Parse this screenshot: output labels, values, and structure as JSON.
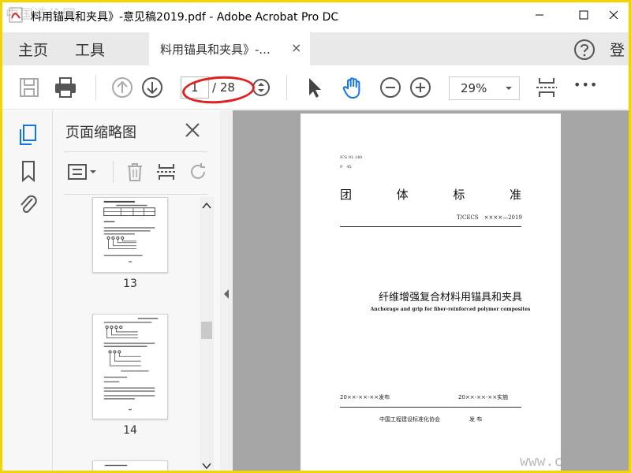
{
  "window": {
    "title": "料用锚具和夹具》-意见稿2019.pdf - Adobe Acrobat Pro DC",
    "watermark": "中国造价网"
  },
  "nav": {
    "home": "主页",
    "tools": "工具",
    "doc_tab": "料用锚具和夹具》-...",
    "close": "×",
    "signin": "登"
  },
  "toolbar": {
    "current_page": "1",
    "total_pages": "/ 28",
    "zoom": "29%",
    "more": "•••"
  },
  "panel": {
    "title": "页面缩略图",
    "thumbnails": [
      {
        "page": "13"
      },
      {
        "page": "14"
      }
    ]
  },
  "document": {
    "ics": "ICS 91.140",
    "p": "P　45",
    "std_chars": [
      "团",
      "体",
      "标",
      "准"
    ],
    "code": "T/CECS　××××—2019",
    "cn_title": "纤维增强复合材料用锚具和夹具",
    "en_title": "Anchorage and grip for fiber-reinforced polymer composites",
    "publish": "20××-××-××发布",
    "implement": "20××-××-××实施",
    "org": "中国工程建设标准化协会",
    "org_suffix": "发 布"
  },
  "site_watermark": "www.c",
  "colors": {
    "border": "#f3d400",
    "accent": "#1473e6",
    "annotation": "#e02020"
  }
}
